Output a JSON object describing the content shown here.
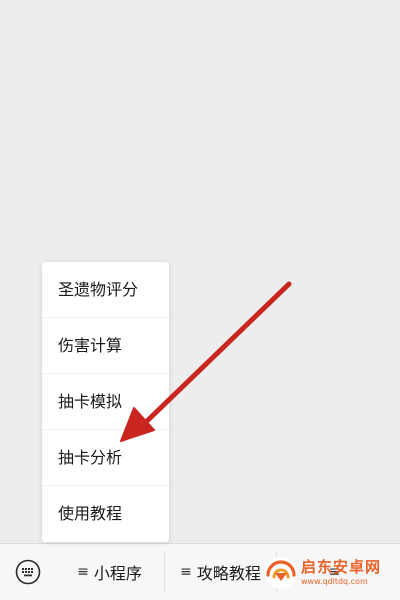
{
  "menu": {
    "items": [
      {
        "label": "圣遗物评分"
      },
      {
        "label": "伤害计算"
      },
      {
        "label": "抽卡模拟"
      },
      {
        "label": "抽卡分析"
      },
      {
        "label": "使用教程"
      }
    ]
  },
  "bottom_bar": {
    "keyboard_icon": "keyboard-icon",
    "tabs": [
      {
        "icon": "≡",
        "label": "小程序"
      },
      {
        "icon": "≡",
        "label": "攻略教程"
      },
      {
        "icon": "≡",
        "label": ""
      }
    ]
  },
  "annotation": {
    "arrow_color": "#c8261f"
  },
  "watermark": {
    "title": "启东安卓网",
    "url": "www.qdltdq.com",
    "accent": "#e8622a"
  }
}
